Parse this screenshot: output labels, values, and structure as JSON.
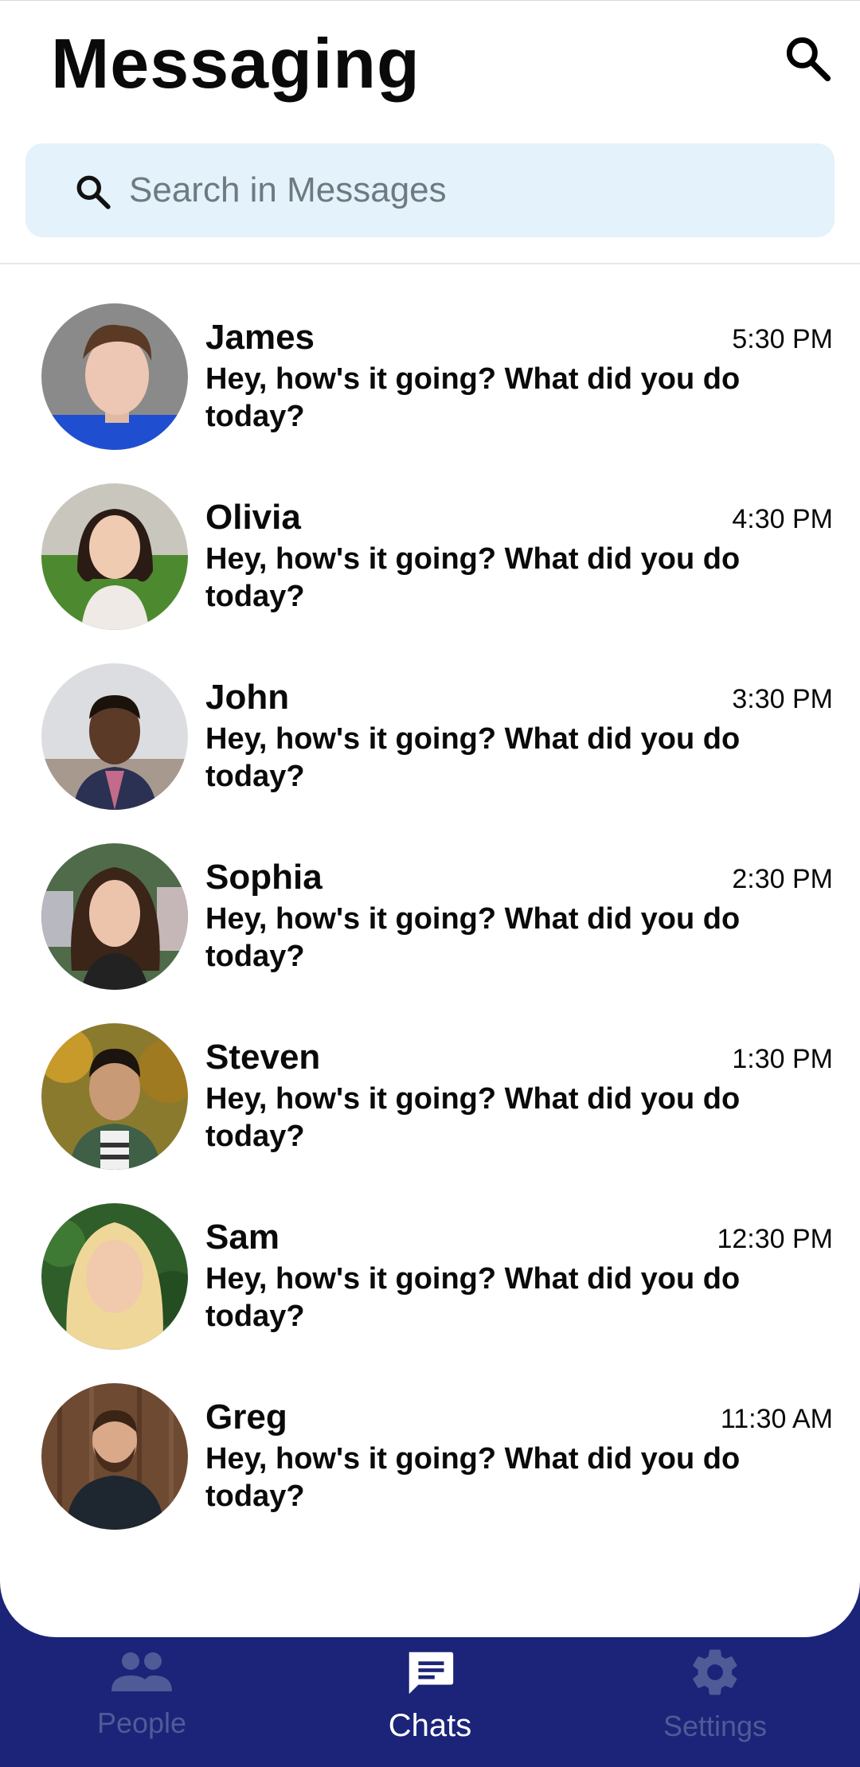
{
  "header": {
    "title": "Messaging"
  },
  "search": {
    "placeholder": "Search in Messages",
    "value": ""
  },
  "chats": [
    {
      "name": "James",
      "time": "5:30 PM",
      "message": "Hey, how's it going? What did you do today?"
    },
    {
      "name": "Olivia",
      "time": "4:30 PM",
      "message": "Hey, how's it going? What did you do today?"
    },
    {
      "name": "John",
      "time": "3:30 PM",
      "message": "Hey, how's it going? What did you do today?"
    },
    {
      "name": "Sophia",
      "time": "2:30 PM",
      "message": "Hey, how's it going? What did you do today?"
    },
    {
      "name": "Steven",
      "time": "1:30 PM",
      "message": "Hey, how's it going? What did you do today?"
    },
    {
      "name": "Sam",
      "time": "12:30 PM",
      "message": "Hey, how's it going? What did you do today?"
    },
    {
      "name": "Greg",
      "time": "11:30 AM",
      "message": "Hey, how's it going? What did you do today?"
    }
  ],
  "nav": {
    "people": "People",
    "chats": "Chats",
    "settings": "Settings",
    "active": "chats"
  },
  "colors": {
    "nav_background": "#1b2478",
    "search_background": "#e3f2fb",
    "nav_inactive": "#4f5b97",
    "nav_active": "#ffffff"
  },
  "icons": {
    "top_search": "search-icon",
    "search_bar": "search-icon",
    "people": "people-icon",
    "chats": "chat-bubble-icon",
    "settings": "gear-icon"
  }
}
